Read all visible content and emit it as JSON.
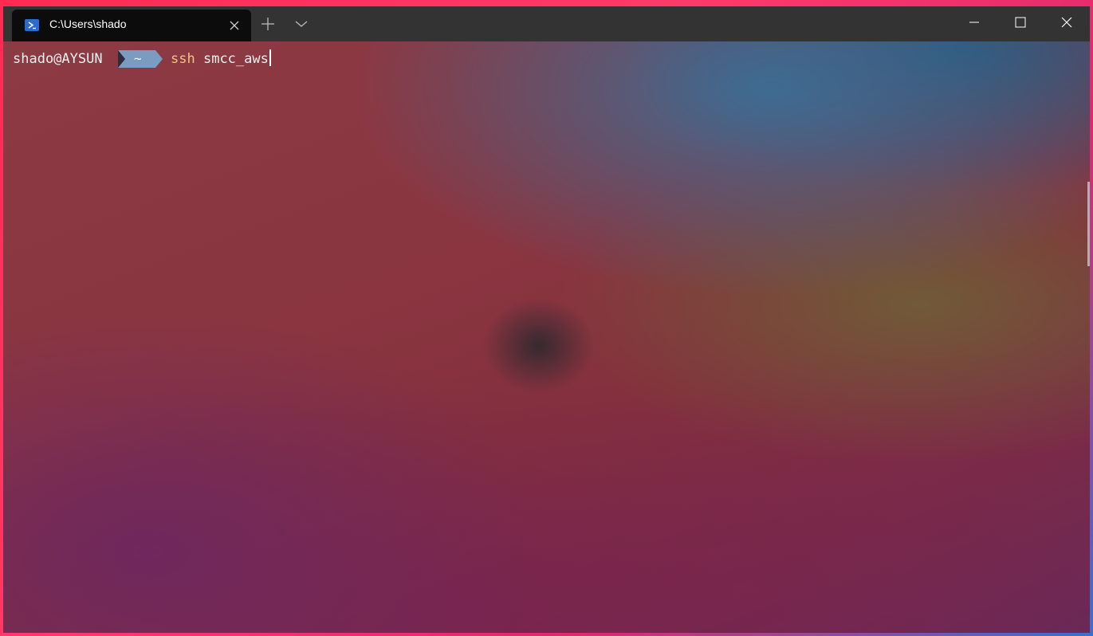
{
  "titlebar": {
    "tab": {
      "title": "C:\\Users\\shado",
      "icon": "powershell-icon",
      "close_icon": "close-icon"
    },
    "new_tab_icon": "plus-icon",
    "dropdown_icon": "chevron-down-icon",
    "window_controls": [
      "minimize-icon",
      "maximize-icon",
      "close-icon"
    ]
  },
  "terminal": {
    "user_host": "shado@AYSUN",
    "path_segment": "~",
    "command_name": "ssh",
    "command_arg": "smcc_aws"
  },
  "colors": {
    "segment_bg": "#7a9cc0",
    "command_name": "#f4c37a",
    "tab_bg": "#0c0c0c",
    "titlebar_bg": "#333333"
  }
}
